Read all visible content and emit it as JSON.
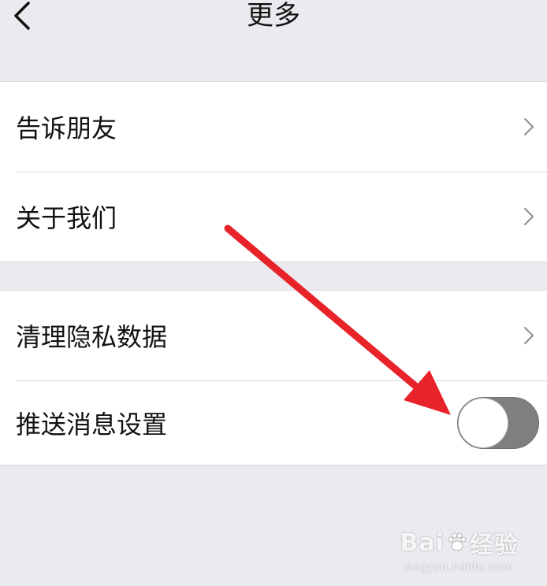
{
  "nav": {
    "title": "更多",
    "back_icon": "chevron-left-icon"
  },
  "groups": [
    {
      "rows": [
        {
          "label": "告诉朋友",
          "accessory": "chevron-right-icon"
        },
        {
          "label": "关于我们",
          "accessory": "chevron-right-icon"
        }
      ]
    },
    {
      "rows": [
        {
          "label": "清理隐私数据",
          "accessory": "chevron-right-icon"
        },
        {
          "label": "推送消息设置",
          "accessory": "toggle",
          "toggle_on": false
        }
      ]
    }
  ],
  "annotation": {
    "type": "arrow",
    "color": "#e8232a"
  },
  "watermark": {
    "brand_left": "Bai",
    "brand_right": "经验",
    "url": "jingyan.baidu.com"
  },
  "colors": {
    "background": "#ebeaef",
    "cell": "#ffffff",
    "separator": "#d9d9de",
    "toggle_off_track": "#7f7f7f"
  }
}
